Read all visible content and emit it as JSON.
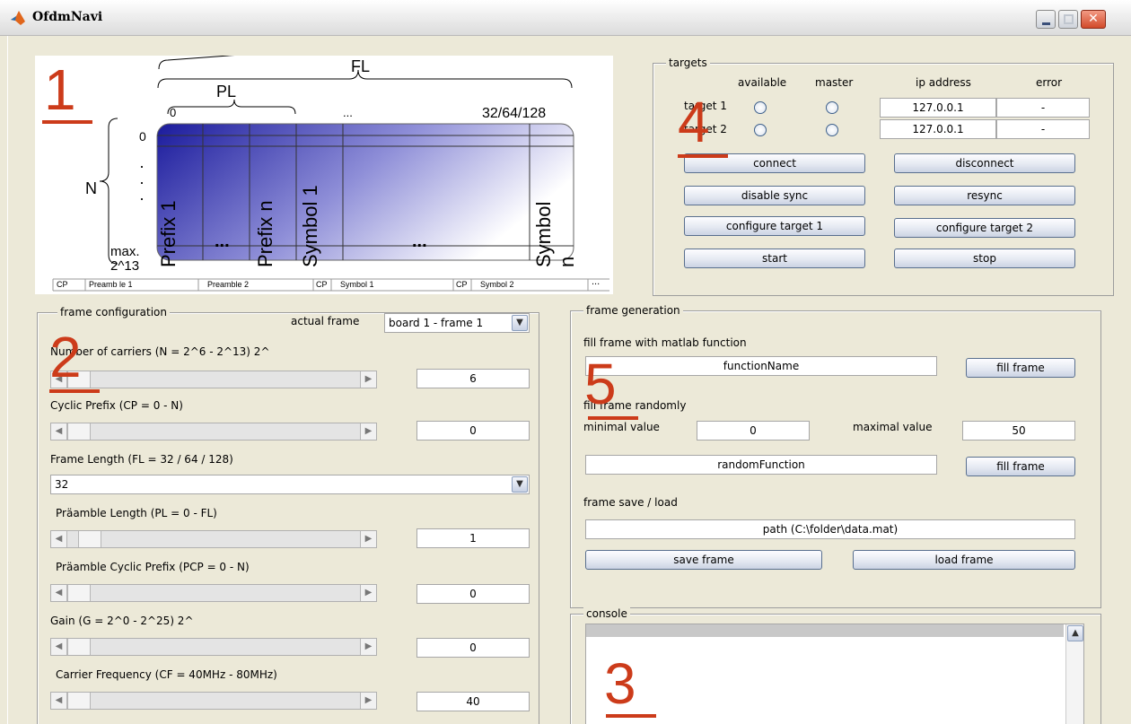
{
  "window": {
    "title": "OfdmNavi",
    "close_glyph": "✕"
  },
  "overlay_numbers": [
    "1",
    "2",
    "3",
    "4",
    "5"
  ],
  "diagram": {
    "FL": "FL",
    "PL": "PL",
    "N": "N",
    "zero_top": "0",
    "zero_side": "0",
    "ellipsis_top": "...",
    "sizes": "32/64/128",
    "max": "max.",
    "max_val": "2^13",
    "columns": [
      "Prefix 1",
      "...",
      "Prefix n",
      "Symbol 1",
      "...",
      "Symbol n"
    ],
    "row_legend": [
      "CP",
      "Preamb le 1",
      "Preamble 2",
      "CP",
      "Symbol 1",
      "CP",
      "Symbol 2",
      "..."
    ]
  },
  "targets": {
    "title": "targets",
    "headers": {
      "available": "available",
      "master": "master",
      "ip": "ip address",
      "error": "error"
    },
    "rows": [
      {
        "label": "target 1",
        "ip": "127.0.0.1",
        "error": "-"
      },
      {
        "label": "target 2",
        "ip": "127.0.0.1",
        "error": "-"
      }
    ],
    "buttons": {
      "connect": "connect",
      "disconnect": "disconnect",
      "disable_sync": "disable sync",
      "resync": "resync",
      "configure1": "configure target 1",
      "configure2": "configure target 2",
      "start": "start",
      "stop": "stop"
    }
  },
  "frame_config": {
    "title": "frame configuration",
    "actual_frame_label": "actual frame",
    "actual_frame_value": "board 1 - frame 1",
    "carriers": {
      "label": "Number of carriers (N = 2^6 - 2^13) 2^",
      "value": "6",
      "level": 0
    },
    "cp": {
      "label": "Cyclic Prefix (CP = 0 - N)",
      "value": "0",
      "level": 0
    },
    "frame_length": {
      "label": "Frame Length (FL = 32 / 64 / 128)",
      "value": "32"
    },
    "pl": {
      "label": "Präamble Length (PL = 0 - FL)",
      "value": "1",
      "level": 0.03
    },
    "pcp": {
      "label": "Präamble Cyclic Prefix (PCP = 0 - N)",
      "value": "0",
      "level": 0
    },
    "gain": {
      "label": "Gain (G = 2^0 - 2^25) 2^",
      "value": "0",
      "level": 0
    },
    "cf": {
      "label": "Carrier Frequency (CF = 40MHz - 80MHz)",
      "value": "40",
      "level": 0
    }
  },
  "frame_gen": {
    "title": "frame generation",
    "matlab_label": "fill frame with matlab function",
    "function_name": "functionName",
    "fill_frame": "fill frame",
    "random_label": "fill frame randomly",
    "min_label": "minimal value",
    "min_value": "0",
    "max_label": "maximal value",
    "max_value": "50",
    "random_function": "randomFunction",
    "save_load_label": "frame save / load",
    "path": "path (C:\\folder\\data.mat)",
    "save": "save frame",
    "load": "load frame"
  },
  "console": {
    "title": "console"
  },
  "arrows": {
    "left": "◀",
    "right": "▶",
    "down": "▼",
    "up": "▲"
  },
  "colors": {
    "accent_red": "#cc3b1a",
    "gradient_dark": "#1a1a9c"
  }
}
